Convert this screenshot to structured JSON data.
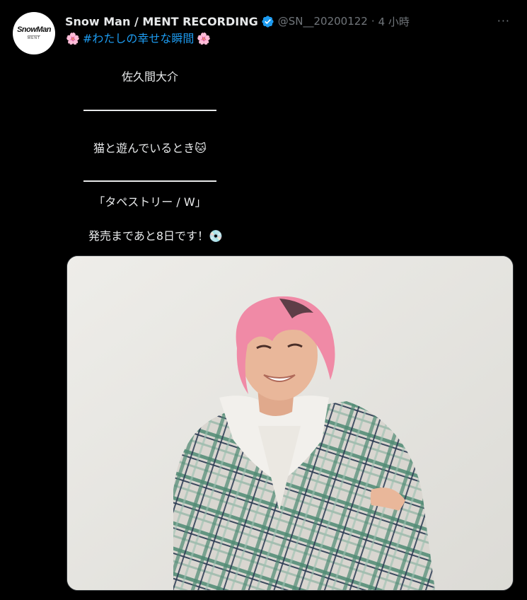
{
  "account": {
    "avatar_text_main": "SnowMan",
    "avatar_text_sub": "MENT",
    "display_name": "Snow Man / MENT RECORDING",
    "handle": "@SN__20200122",
    "separator": "·",
    "time": "4 小時",
    "more_label": "···",
    "verified_icon": "verified-badge-icon"
  },
  "tweet": {
    "blossom": "🌸",
    "hashtag": "#わたしの幸せな瞬間",
    "line_name": "佐久間大介",
    "line_moment": "猫と遊んでいるとき🐱",
    "line_title": "「タペストリー / W」",
    "line_release": "発売まであと8日です！💿"
  },
  "media": {
    "alt": "photo",
    "colors": {
      "wall": "#e8e7e3",
      "hair": "#f08aa6",
      "hoodie": "#f2f0ec",
      "coat_base": "#d9d6d0",
      "coat_green": "#4f8a73",
      "coat_navy": "#2a3a52",
      "skin": "#e9b79a"
    }
  },
  "colors": {
    "background": "#000000",
    "text": "#e7e9ea",
    "muted": "#71767b",
    "link": "#1d9bf0",
    "verified": "#1d9bf0"
  }
}
